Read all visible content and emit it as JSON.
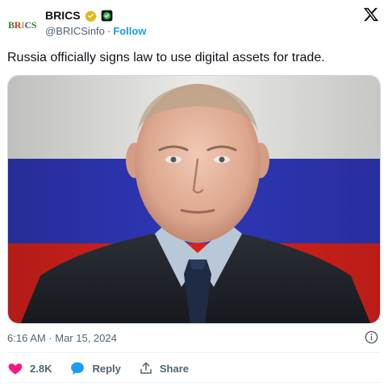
{
  "header": {
    "display_name": "BRICS",
    "handle": "@BRICSinfo",
    "separator": "·",
    "follow_label": "Follow",
    "avatar_text": "BRICS",
    "colors": {
      "follow": "#1d9bf0",
      "verified": "#e2b719"
    }
  },
  "tweet": {
    "text": "Russia officially signs law to use digital assets for trade.",
    "timestamp": "6:16 AM · Mar 15, 2024"
  },
  "actions": {
    "likes": "2.8K",
    "reply_label": "Reply",
    "share_label": "Share",
    "colors": {
      "like": "#f91880",
      "reply": "#1d9bf0"
    }
  },
  "icons": [
    "brics-logo-icon",
    "verified-badge-icon",
    "affiliate-badge-icon",
    "x-logo-icon",
    "info-icon",
    "heart-icon",
    "reply-icon",
    "share-icon"
  ]
}
